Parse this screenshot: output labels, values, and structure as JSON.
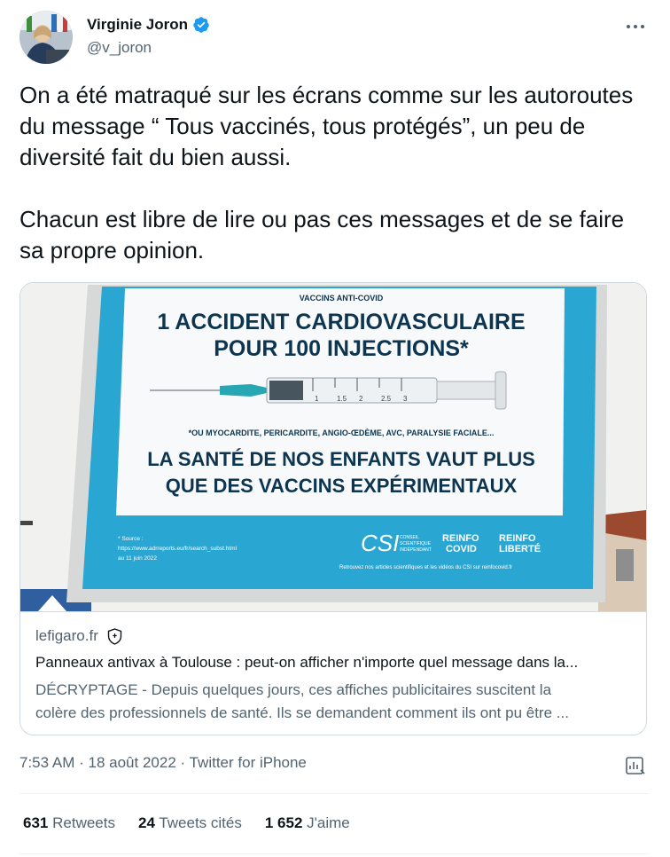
{
  "author": {
    "name": "Virginie Joron",
    "handle": "@v_joron",
    "verified": true
  },
  "tweet": {
    "paragraphs": [
      "On a été matraqué sur les écrans comme sur les autoroutes du message “ Tous vaccinés, tous protégés”, un peu de diversité fait du bien aussi.",
      "Chacun est libre de lire ou pas ces messages et de se faire sa propre opinion."
    ]
  },
  "card": {
    "billboard": {
      "kicker": "VACCINS ANTI-COVID",
      "headline_line1": "1 ACCIDENT CARDIOVASCULAIRE",
      "headline_line2": "POUR 100 INJECTIONS*",
      "footnote": "*OU MYOCARDITE, PERICARDITE, ANGIO-ŒDÈME, AVC, PARALYSIE FACIALE...",
      "slogan_line1": "LA SANTÉ DE NOS ENFANTS VAUT PLUS",
      "slogan_line2": "QUE DES VACCINS EXPÉRIMENTAUX",
      "source_line1": "* Source :",
      "source_line2": "https://www.adrreports.eu/fr/search_subst.html",
      "source_line3": "au 11 juin 2022",
      "csi_logo_text": "CSI",
      "csi_caption_1": "CONSEIL",
      "csi_caption_2": "SCIENTIFIQUE",
      "csi_caption_3": "INDÉPENDANT",
      "logo_reinfo_covid_1": "REINFO",
      "logo_reinfo_covid_2": "COVID",
      "logo_reinfo_liberte_1": "REINFO",
      "logo_reinfo_liberte_2": "LIBERTÉ",
      "bottom_line": "Retrouvez nos articles scientifiques et les vidéos du CSI sur reinfocovid.fr",
      "syringe_marks": [
        "1",
        "1.5",
        "2",
        "2.5",
        "3"
      ]
    },
    "domain": "lefigaro.fr",
    "title": "Panneaux antivax à Toulouse : peut-on afficher n'importe quel message dans la...",
    "description_line1": "DÉCRYPTAGE - Depuis quelques jours, ces affiches publicitaires suscitent la",
    "description_line2": "colère des professionnels de santé. Ils se demandent comment ils ont pu être ..."
  },
  "meta": {
    "time": "7:53 AM",
    "sep1": "·",
    "date": "18 août 2022",
    "sep2": "·",
    "client": "Twitter for iPhone"
  },
  "stats": {
    "retweets_count": "631",
    "retweets_label": "Retweets",
    "quotes_count": "24",
    "quotes_label": "Tweets cités",
    "likes_count": "1 652",
    "likes_label": "J'aime"
  },
  "colors": {
    "verified": "#1d9bf0",
    "billboard_blue": "#2aa6d3",
    "billboard_navy": "#0d3550"
  }
}
